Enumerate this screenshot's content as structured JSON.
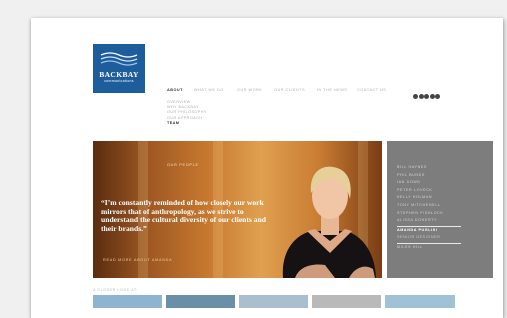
{
  "brand": {
    "name": "BACKBAY",
    "tagline": "communications",
    "color": "#1e5d9c"
  },
  "nav": {
    "items": [
      "ABOUT",
      "WHAT WE DO",
      "OUR WORK",
      "OUR CLIENTS",
      "IN THE NEWS",
      "CONTACT US"
    ],
    "active": "ABOUT"
  },
  "sub_nav": {
    "items": [
      "OVERVIEW",
      "WHY BACKBAY",
      "OUR PHILOSOPHY",
      "OUR APPROACH",
      "TEAM"
    ],
    "active": "TEAM"
  },
  "social": {
    "icons": [
      "facebook-icon",
      "twitter-icon",
      "linkedin-icon",
      "youtube-icon",
      "blog-icon"
    ]
  },
  "hero": {
    "label": "OUR PEOPLE",
    "quote": "“I’m constantly reminded of how closely our work mirrors that of anthropology, as we strive to understand the cultural diversity of our clients and their brands.”",
    "read_more": "READ MORE ABOUT AMANDA"
  },
  "people": {
    "before": [
      "BILL HAYNES",
      "PHIL BUNDS",
      "IAN DOWD",
      "PETER LOVECK",
      "KELLY HOLMAN",
      "TONY MITCHENELL",
      "STEPHEN FISHLOCK",
      "ALISSA DOHERTY"
    ],
    "selected": {
      "name": "AMANDA PUGLISI",
      "role": "SENIOR DESIGNER"
    },
    "after": [
      "MILES HILL"
    ]
  },
  "closer_look": {
    "label": "A CLOSER LOOK AT:"
  }
}
